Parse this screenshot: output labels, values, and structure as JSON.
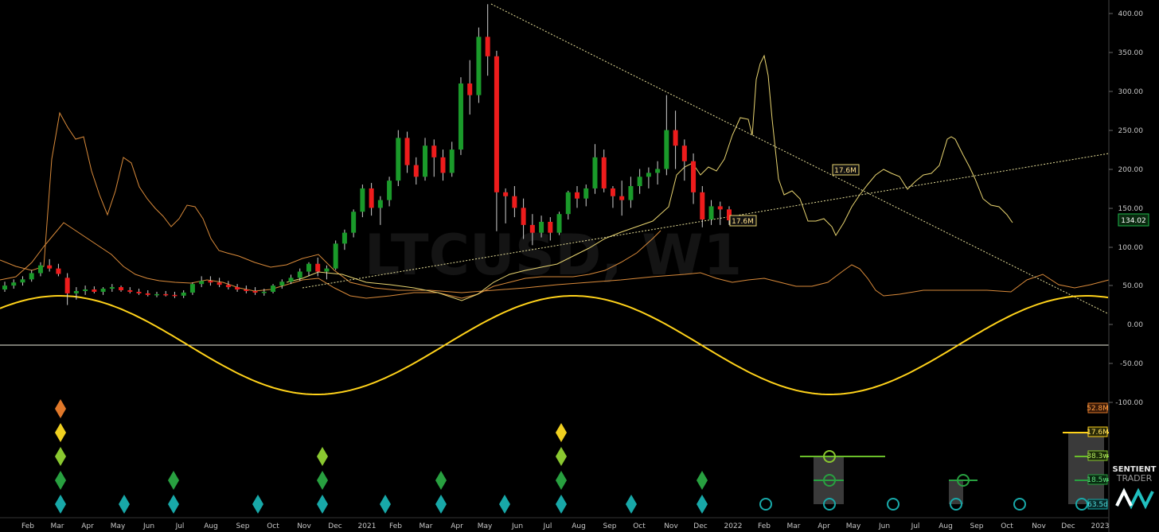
{
  "watermark": "LTCUSD, W1",
  "brand": {
    "line1": "SENTIENT",
    "line2": "TRADER"
  },
  "colors": {
    "background": "#000000",
    "bull": "#1a9a2a",
    "bear": "#ee1c1c",
    "cycle": "#ffd21a",
    "trendline": "#e8e09a",
    "envelope": "#d98a3a",
    "price_tag": "#1db84a"
  },
  "chart_data": {
    "type": "candlestick",
    "symbol": "LTCUSD",
    "timeframe": "W1",
    "ylim": [
      -120,
      410
    ],
    "y_ticks": [
      "400.00",
      "350.00",
      "300.00",
      "250.00",
      "200.00",
      "150.00",
      "100.00",
      "50.00",
      "0.00",
      "-50.00",
      "-100.00"
    ],
    "x_months": [
      "Feb",
      "Mar",
      "Apr",
      "May",
      "Jun",
      "Jul",
      "Aug",
      "Sep",
      "Oct",
      "Nov",
      "Dec",
      "2021",
      "Feb",
      "Mar",
      "Apr",
      "May",
      "Jun",
      "Jul",
      "Aug",
      "Sep",
      "Oct",
      "Nov",
      "Dec",
      "2022",
      "Feb",
      "Mar",
      "Apr",
      "May",
      "Jun",
      "Jul",
      "Aug",
      "Sep",
      "Oct",
      "Nov",
      "Dec",
      "2023"
    ],
    "last_price": "134.02",
    "candles": [
      [
        45,
        55,
        42,
        50
      ],
      [
        50,
        58,
        46,
        54
      ],
      [
        54,
        62,
        50,
        58
      ],
      [
        58,
        70,
        55,
        66
      ],
      [
        66,
        80,
        62,
        76
      ],
      [
        76,
        84,
        68,
        72
      ],
      [
        72,
        78,
        62,
        65
      ],
      [
        60,
        66,
        25,
        40
      ],
      [
        40,
        48,
        32,
        43
      ],
      [
        43,
        50,
        38,
        45
      ],
      [
        45,
        49,
        40,
        42
      ],
      [
        42,
        48,
        38,
        46
      ],
      [
        46,
        52,
        42,
        48
      ],
      [
        48,
        50,
        42,
        44
      ],
      [
        44,
        48,
        40,
        42
      ],
      [
        42,
        46,
        38,
        40
      ],
      [
        40,
        44,
        36,
        38
      ],
      [
        38,
        42,
        35,
        39
      ],
      [
        39,
        43,
        36,
        38
      ],
      [
        38,
        42,
        34,
        37
      ],
      [
        37,
        44,
        34,
        41
      ],
      [
        41,
        54,
        38,
        52
      ],
      [
        52,
        62,
        48,
        56
      ],
      [
        56,
        62,
        50,
        54
      ],
      [
        54,
        60,
        48,
        51
      ],
      [
        51,
        56,
        45,
        48
      ],
      [
        48,
        52,
        42,
        45
      ],
      [
        45,
        50,
        40,
        43
      ],
      [
        43,
        48,
        38,
        41
      ],
      [
        41,
        46,
        37,
        42
      ],
      [
        42,
        52,
        40,
        50
      ],
      [
        50,
        58,
        46,
        55
      ],
      [
        55,
        64,
        52,
        60
      ],
      [
        60,
        72,
        56,
        68
      ],
      [
        68,
        80,
        62,
        78
      ],
      [
        78,
        86,
        62,
        68
      ],
      [
        68,
        76,
        58,
        72
      ],
      [
        72,
        108,
        70,
        104
      ],
      [
        104,
        122,
        96,
        118
      ],
      [
        118,
        148,
        112,
        145
      ],
      [
        145,
        180,
        138,
        175
      ],
      [
        175,
        182,
        140,
        150
      ],
      [
        150,
        165,
        128,
        160
      ],
      [
        160,
        190,
        152,
        185
      ],
      [
        185,
        250,
        178,
        240
      ],
      [
        240,
        248,
        195,
        205
      ],
      [
        205,
        215,
        180,
        190
      ],
      [
        190,
        240,
        185,
        230
      ],
      [
        230,
        238,
        190,
        215
      ],
      [
        215,
        225,
        185,
        195
      ],
      [
        195,
        235,
        190,
        225
      ],
      [
        225,
        318,
        218,
        310
      ],
      [
        310,
        340,
        270,
        295
      ],
      [
        295,
        382,
        285,
        370
      ],
      [
        370,
        412,
        320,
        345
      ],
      [
        345,
        352,
        120,
        170
      ],
      [
        170,
        175,
        130,
        165
      ],
      [
        165,
        178,
        138,
        150
      ],
      [
        150,
        162,
        110,
        128
      ],
      [
        128,
        142,
        102,
        118
      ],
      [
        118,
        140,
        112,
        132
      ],
      [
        132,
        138,
        108,
        118
      ],
      [
        118,
        145,
        115,
        142
      ],
      [
        142,
        172,
        135,
        170
      ],
      [
        170,
        178,
        150,
        162
      ],
      [
        162,
        180,
        152,
        175
      ],
      [
        175,
        232,
        168,
        215
      ],
      [
        215,
        225,
        170,
        175
      ],
      [
        175,
        178,
        150,
        165
      ],
      [
        165,
        185,
        140,
        160
      ],
      [
        160,
        190,
        150,
        178
      ],
      [
        178,
        200,
        168,
        190
      ],
      [
        190,
        202,
        175,
        195
      ],
      [
        195,
        210,
        180,
        200
      ],
      [
        200,
        295,
        192,
        250
      ],
      [
        250,
        275,
        200,
        230
      ],
      [
        230,
        238,
        185,
        210
      ],
      [
        210,
        220,
        155,
        170
      ],
      [
        170,
        178,
        125,
        135
      ],
      [
        135,
        160,
        128,
        152
      ],
      [
        152,
        158,
        128,
        148
      ],
      [
        148,
        152,
        128,
        134
      ]
    ]
  },
  "tags": {
    "trend_upper": "17.6M",
    "trend_lower": "17.6M",
    "right_52": "52.8M",
    "right_176": "17.6M",
    "right_383": "38.3w",
    "right_185": "18.5w",
    "right_635": "63.5d"
  }
}
